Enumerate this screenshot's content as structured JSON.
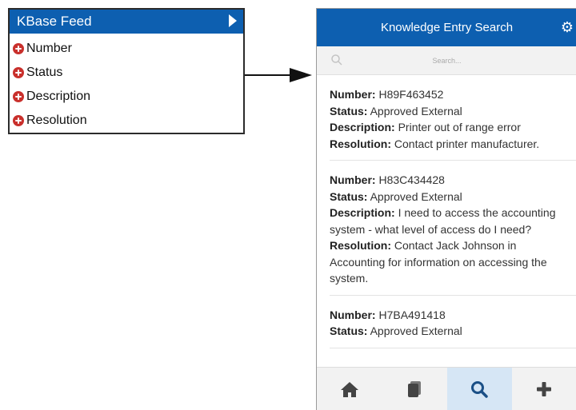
{
  "feed": {
    "title": "KBase Feed",
    "fields": [
      "Number",
      "Status",
      "Description",
      "Resolution"
    ]
  },
  "app": {
    "title": "Knowledge Entry Search",
    "search_placeholder": "Search...",
    "labels": {
      "number": "Number:",
      "status": "Status:",
      "description": "Description:",
      "resolution": "Resolution:"
    },
    "entries": [
      {
        "number": "H89F463452",
        "status": "Approved External",
        "description": "Printer out of range error",
        "resolution": "Contact printer manufacturer."
      },
      {
        "number": "H83C434428",
        "status": "Approved External",
        "description": "I need to access the accounting system - what level of access do I need?",
        "resolution": "Contact Jack Johnson in Accounting for information on accessing the system."
      },
      {
        "number": "H7BA491418",
        "status": "Approved External",
        "description": "",
        "resolution": ""
      }
    ],
    "tabs": [
      "home-icon",
      "documents-icon",
      "search-icon",
      "add-icon"
    ],
    "active_tab": "search-icon"
  },
  "colors": {
    "header_blue": "#0d5fb0",
    "remove_red": "#c9302c",
    "active_tab": "#d6e6f5"
  }
}
